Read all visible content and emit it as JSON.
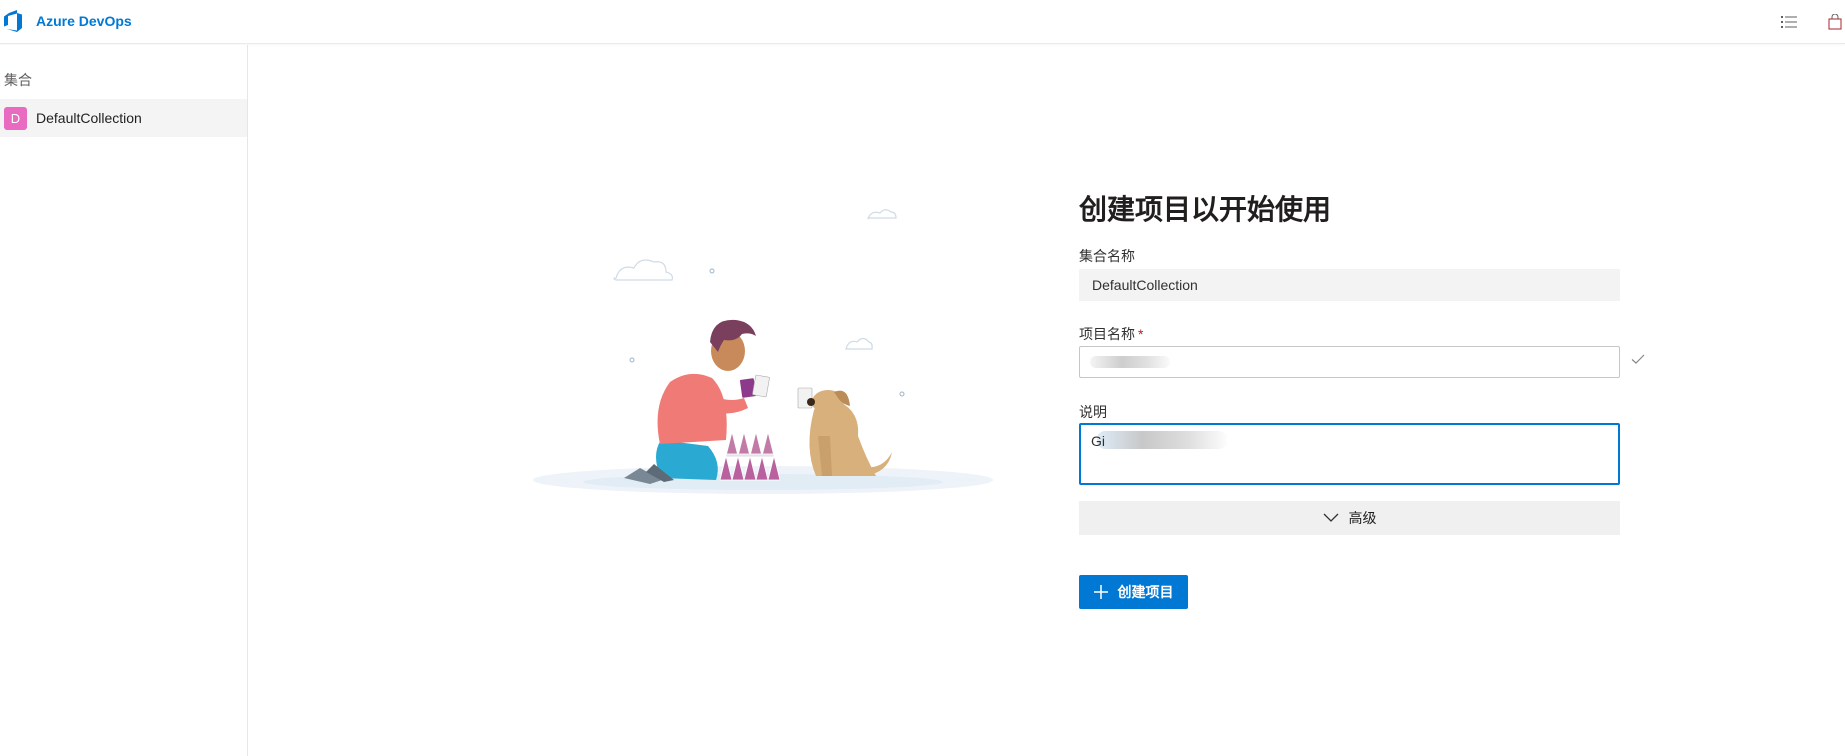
{
  "header": {
    "brand": "Azure DevOps",
    "icons": [
      "list-settings-icon",
      "shopping-bag-icon"
    ]
  },
  "sidebar": {
    "heading": "集合",
    "items": [
      {
        "avatar_letter": "D",
        "label": "DefaultCollection",
        "avatar_color": "#e86ac1"
      }
    ]
  },
  "form": {
    "title": "创建项目以开始使用",
    "collection_label": "集合名称",
    "collection_value": "DefaultCollection",
    "project_label": "项目名称",
    "required_marker": "*",
    "project_value": "",
    "description_label": "说明",
    "description_value": "Gi",
    "advanced_label": "高级",
    "create_label": "创建项目"
  },
  "colors": {
    "accent": "#0078d4",
    "required": "#a4262c"
  }
}
